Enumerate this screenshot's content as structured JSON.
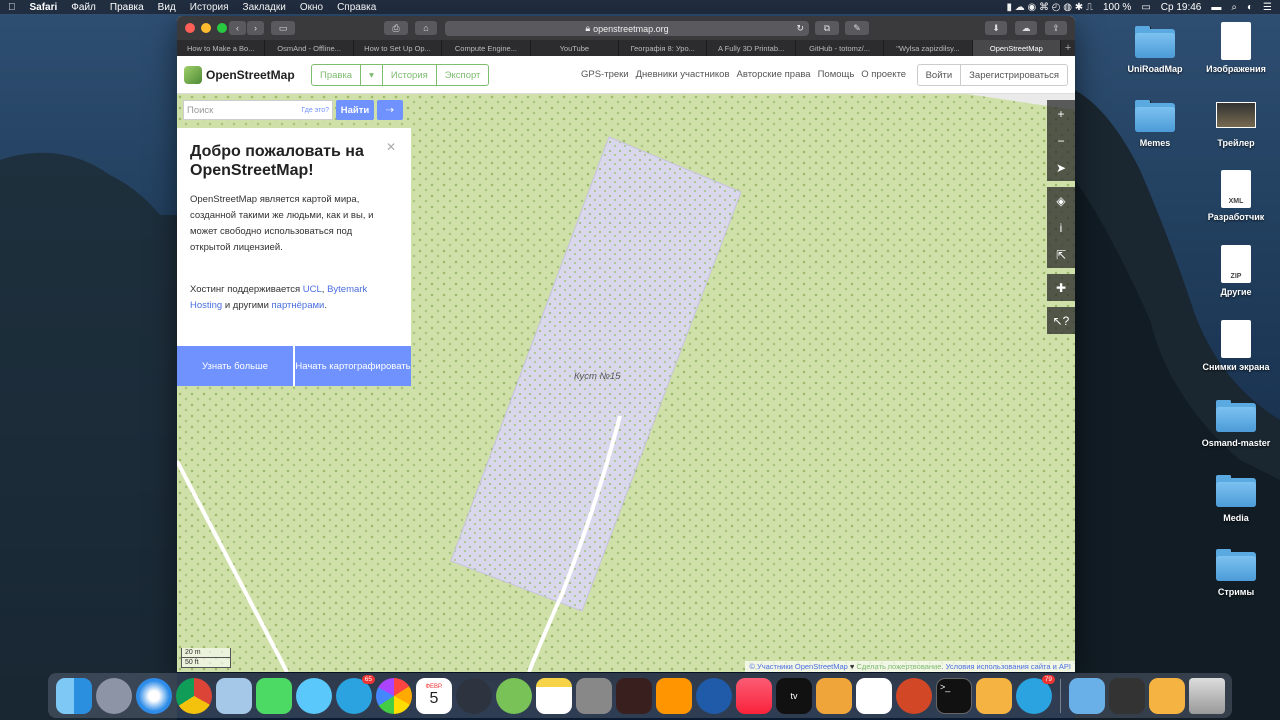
{
  "menubar": {
    "apple": "",
    "app": "Safari",
    "items": [
      "Файл",
      "Правка",
      "Вид",
      "История",
      "Закладки",
      "Окно",
      "Справка"
    ],
    "battery": "100 %",
    "clock": "Ср 19:46"
  },
  "desktop": [
    {
      "label": "UniRoadMap",
      "type": "folder"
    },
    {
      "label": "Изображения",
      "type": "doc"
    },
    {
      "label": "Memes",
      "type": "folder"
    },
    {
      "label": "Трейлер",
      "type": "thumb"
    },
    {
      "label": "Разработчик",
      "type": "doc",
      "tag": "XML"
    },
    {
      "label": "Другие",
      "type": "doc",
      "tag": "ZIP"
    },
    {
      "label": "Снимки экрана",
      "type": "doc"
    },
    {
      "label": "Osmand-master",
      "type": "folder"
    },
    {
      "label": "Media",
      "type": "folder"
    },
    {
      "label": "Стримы",
      "type": "folder"
    }
  ],
  "browser": {
    "url": "openstreetmap.org",
    "tabs": [
      "How to Make a Bo...",
      "OsmAnd - Offline...",
      "How to Set Up Op...",
      "Compute Engine...",
      "YouTube",
      "Географія 8: Уро...",
      "A Fully 3D Printab...",
      "GitHub - totomz/...",
      "\"Wylsa zapizdilsy...",
      "OpenStreetMap"
    ],
    "active_tab": 9
  },
  "osm": {
    "logo": "OpenStreetMap",
    "edit": [
      "Правка",
      "▾",
      "История",
      "Экспорт"
    ],
    "nav": [
      "GPS-треки",
      "Дневники участников",
      "Авторские права",
      "Помощь",
      "О проекте"
    ],
    "login": "Войти",
    "signup": "Зарегистрироваться",
    "search_placeholder": "Поиск",
    "where": "Где это?",
    "go": "Найти",
    "welcome": {
      "title": "Добро пожаловать на OpenStreetMap!",
      "body": "OpenStreetMap является картой мира, созданной такими же людьми, как и вы, и может свободно использоваться под открытой лицензией.",
      "host_prefix": "Хостинг поддерживается ",
      "host_ucl": "UCL",
      "host_sep": ", ",
      "host_bytemark": "Bytemark Hosting",
      "host_mid": " и другими ",
      "host_partners": "партнёрами",
      "host_end": ".",
      "learn_more": "Узнать больше",
      "start_mapping": "Начать картографировать"
    },
    "map_label": "Куст №15",
    "scale_m": "20 m",
    "scale_ft": "50 ft",
    "attribution": {
      "a": "© Участники OpenStreetMap",
      "heart": " ♥ ",
      "donate": "Сделать пожертвование",
      "terms": ". Условия использования сайта и API"
    }
  },
  "dock": {
    "apps": [
      "finder",
      "launchpad",
      "safari",
      "chrome",
      "mail",
      "facetime",
      "messages",
      "telegram",
      "photos",
      "calendar",
      "resolve",
      "android-studio",
      "notes",
      "disk-utility",
      "audio",
      "calculator",
      "quicktime",
      "music",
      "apple-tv",
      "keynote",
      "numbers",
      "powerpoint",
      "terminal",
      "sublime",
      "telegram2"
    ],
    "badges": {
      "telegram": "65",
      "telegram2": "79"
    },
    "calendar_month": "ФЕВР.",
    "calendar_day": "5",
    "colors": {
      "accent": "#7092ff",
      "osm_green": "#7ebc6f",
      "wood": "#cfe0a9",
      "orchard": "#d9d7ec"
    }
  }
}
